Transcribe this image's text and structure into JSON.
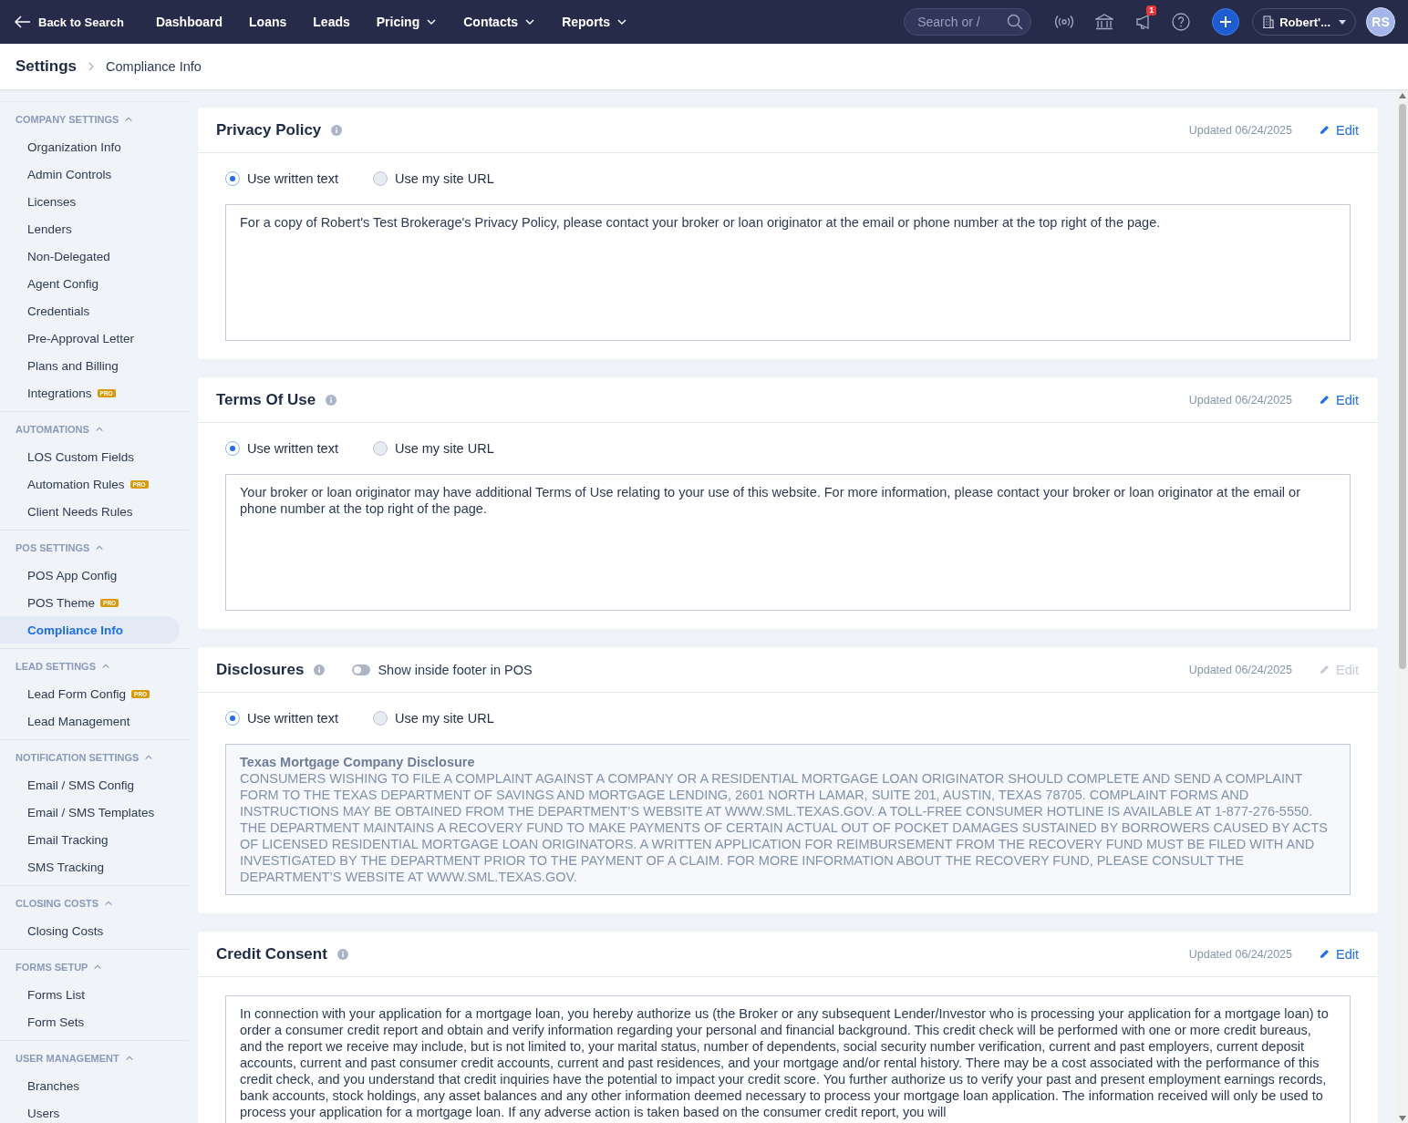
{
  "nav": {
    "back": "Back to Search",
    "items": [
      {
        "label": "Dashboard",
        "dropdown": false
      },
      {
        "label": "Loans",
        "dropdown": false
      },
      {
        "label": "Leads",
        "dropdown": false
      },
      {
        "label": "Pricing",
        "dropdown": true
      },
      {
        "label": "Contacts",
        "dropdown": true
      },
      {
        "label": "Reports",
        "dropdown": true
      }
    ],
    "search": {
      "placeholder": "Search or /"
    },
    "notification_count": "1",
    "account": "Robert'...",
    "avatar": "RS"
  },
  "breadcrumb": [
    "Settings",
    "Compliance Info"
  ],
  "sidebar": {
    "sections": [
      {
        "title": "COMPANY SETTINGS",
        "expanded": true,
        "items": [
          {
            "label": "Organization Info",
            "selected": false
          },
          {
            "label": "Admin Controls",
            "selected": false
          },
          {
            "label": "Licenses",
            "selected": false
          },
          {
            "label": "Lenders",
            "selected": false
          },
          {
            "label": "Non-Delegated",
            "selected": false
          },
          {
            "label": "Agent Config",
            "selected": false
          },
          {
            "label": "Credentials",
            "selected": false
          },
          {
            "label": "Pre-Approval Letter",
            "selected": false
          },
          {
            "label": "Plans and Billing",
            "selected": false
          },
          {
            "label": "Integrations",
            "badge": "PRO",
            "selected": false
          }
        ]
      },
      {
        "title": "AUTOMATIONS",
        "expanded": true,
        "items": [
          {
            "label": "LOS Custom Fields",
            "selected": false
          },
          {
            "label": "Automation Rules",
            "badge": "PRO",
            "selected": false
          },
          {
            "label": "Client Needs Rules",
            "selected": false
          }
        ]
      },
      {
        "title": "POS SETTINGS",
        "expanded": true,
        "items": [
          {
            "label": "POS App Config",
            "selected": false
          },
          {
            "label": "POS Theme",
            "badge": "PRO",
            "selected": false
          },
          {
            "label": "Compliance Info",
            "selected": true
          }
        ]
      },
      {
        "title": "LEAD SETTINGS",
        "expanded": true,
        "items": [
          {
            "label": "Lead Form Config",
            "badge": "PRO",
            "selected": false
          },
          {
            "label": "Lead Management",
            "selected": false
          }
        ]
      },
      {
        "title": "NOTIFICATION SETTINGS",
        "expanded": true,
        "items": [
          {
            "label": "Email / SMS Config",
            "selected": false
          },
          {
            "label": "Email / SMS Templates",
            "selected": false
          },
          {
            "label": "Email Tracking",
            "selected": false
          },
          {
            "label": "SMS Tracking",
            "selected": false
          }
        ]
      },
      {
        "title": "CLOSING COSTS",
        "expanded": true,
        "items": [
          {
            "label": "Closing Costs",
            "selected": false
          }
        ]
      },
      {
        "title": "FORMS SETUP",
        "expanded": true,
        "items": [
          {
            "label": "Forms List",
            "selected": false
          },
          {
            "label": "Form Sets",
            "selected": false
          }
        ]
      },
      {
        "title": "USER MANAGEMENT",
        "expanded": true,
        "items": [
          {
            "label": "Branches",
            "selected": false
          },
          {
            "label": "Users",
            "selected": false
          }
        ]
      }
    ]
  },
  "cards": [
    {
      "title": "Privacy Policy",
      "updated": "Updated 06/24/2025",
      "edit": {
        "label": "Edit",
        "disabled": false
      },
      "options": [
        {
          "label": "Use written text",
          "selected": true
        },
        {
          "label": "Use my site URL",
          "selected": false
        }
      ],
      "content": {
        "disabled": false,
        "paragraphs": [
          "For a copy of Robert's Test Brokerage's Privacy Policy, please contact your broker or loan originator at the email or phone number at the top right of the page."
        ]
      }
    },
    {
      "title": "Terms Of Use",
      "updated": "Updated 06/24/2025",
      "edit": {
        "label": "Edit",
        "disabled": false
      },
      "options": [
        {
          "label": "Use written text",
          "selected": true
        },
        {
          "label": "Use my site URL",
          "selected": false
        }
      ],
      "content": {
        "disabled": false,
        "paragraphs": [
          "Your broker or loan originator may have additional Terms of Use relating to your use of this website. For more information, please contact your broker or loan originator at the email or phone number at the top right of the page."
        ]
      }
    },
    {
      "title": "Disclosures",
      "toggle": {
        "label": "Show inside footer in POS",
        "on": false
      },
      "updated": "Updated 06/24/2025",
      "edit": {
        "label": "Edit",
        "disabled": true
      },
      "options": [
        {
          "label": "Use written text",
          "selected": true
        },
        {
          "label": "Use my site URL",
          "selected": false
        }
      ],
      "content": {
        "disabled": true,
        "heading": "Texas Mortgage Company Disclosure",
        "paragraphs": [
          "CONSUMERS WISHING TO FILE A COMPLAINT AGAINST A COMPANY OR A RESIDENTIAL MORTGAGE LOAN ORIGINATOR SHOULD COMPLETE AND SEND A COMPLAINT FORM TO THE TEXAS DEPARTMENT OF SAVINGS AND MORTGAGE LENDING, 2601 NORTH LAMAR, SUITE 201, AUSTIN, TEXAS 78705. COMPLAINT FORMS AND INSTRUCTIONS MAY BE OBTAINED FROM THE DEPARTMENT’S WEBSITE AT WWW.SML.TEXAS.GOV. A TOLL-FREE CONSUMER HOTLINE IS AVAILABLE AT 1-877-276-5550.",
          "THE DEPARTMENT MAINTAINS A RECOVERY FUND TO MAKE PAYMENTS OF CERTAIN ACTUAL OUT OF POCKET DAMAGES SUSTAINED BY BORROWERS CAUSED BY ACTS OF LICENSED RESIDENTIAL MORTGAGE LOAN ORIGINATORS. A WRITTEN APPLICATION FOR REIMBURSEMENT FROM THE RECOVERY FUND MUST BE FILED WITH AND INVESTIGATED BY THE DEPARTMENT PRIOR TO THE PAYMENT OF A CLAIM. FOR MORE INFORMATION ABOUT THE RECOVERY FUND, PLEASE CONSULT THE DEPARTMENT’S WEBSITE AT WWW.SML.TEXAS.GOV."
        ]
      }
    },
    {
      "title": "Credit Consent",
      "updated": "Updated 06/24/2025",
      "edit": {
        "label": "Edit",
        "disabled": false
      },
      "content": {
        "disabled": false,
        "paragraphs": [
          "In connection with your application for a mortgage loan, you hereby authorize us (the Broker or any subsequent Lender/Investor who is processing your application for a mortgage loan) to order a consumer credit report and obtain and verify information regarding your personal and financial background. This credit check will be performed with one or more credit bureaus, and the report we receive may include, but is not limited to, your marital status, number of dependents, social security number verification, current and past employers, current deposit accounts, current and past consumer credit accounts, current and past residences, and your mortgage and/or rental history. There may be a cost associated with the performance of this credit check, and you understand that credit inquiries have the potential to impact your credit score. You further authorize us to verify your past and present employment earnings records, bank accounts, stock holdings, any asset balances and any other information deemed necessary to process your mortgage loan application. The information received will only be used to process your application for a mortgage loan. If any adverse action is taken based on the consumer credit report, you will"
        ]
      }
    }
  ]
}
